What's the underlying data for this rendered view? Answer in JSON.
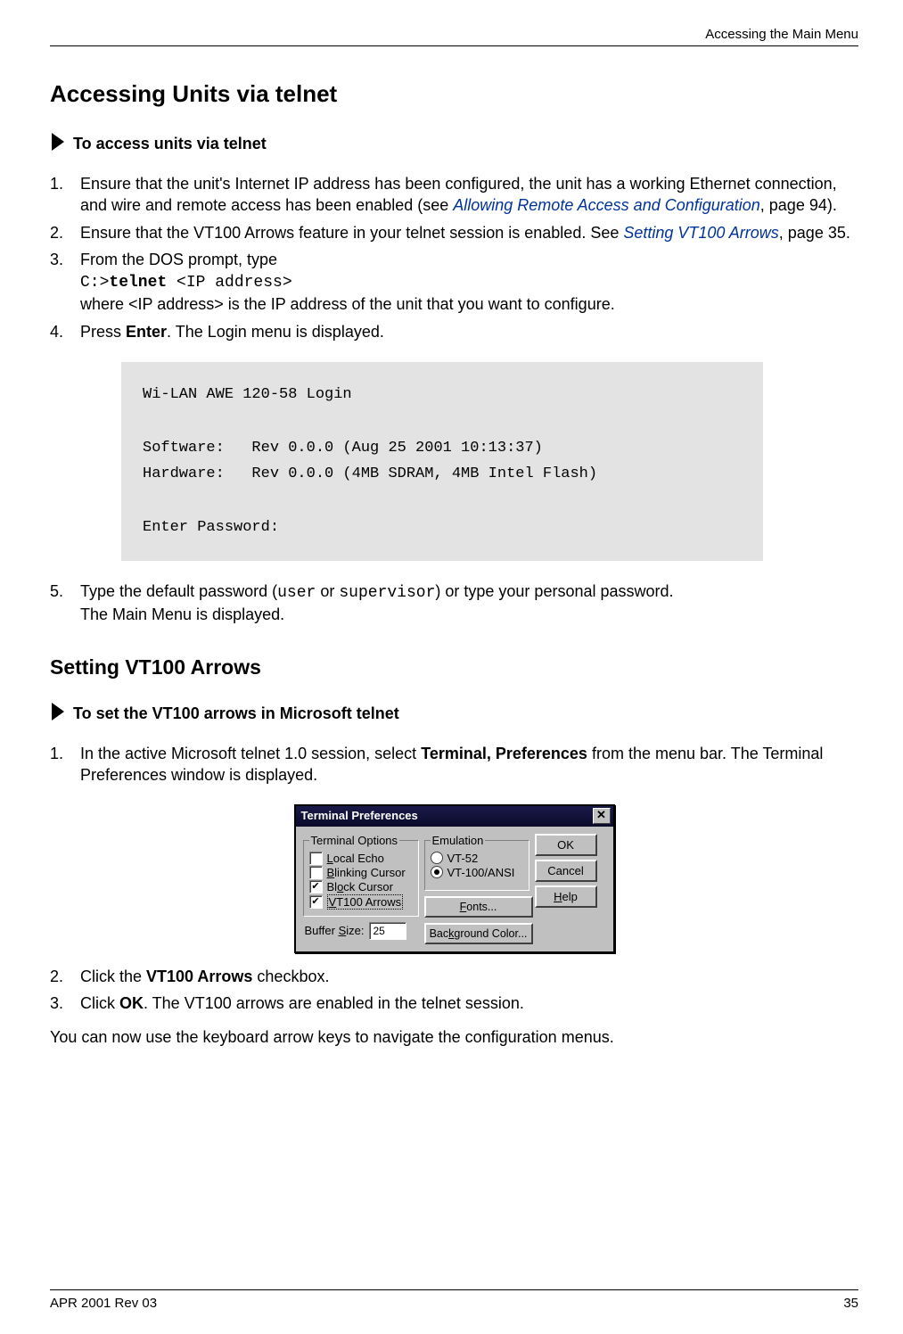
{
  "header": {
    "right": "Accessing the Main Menu"
  },
  "section1": {
    "title": "Accessing Units via telnet",
    "proc_label": "To access units via telnet",
    "steps": {
      "s1a": "Ensure that the unit's Internet IP address has been configured, the unit has a working Ethernet connection, and wire and remote access has been enabled (see ",
      "s1link": "Allowing Remote Access and Configuration",
      "s1b": ", page 94).",
      "s2a": "Ensure that the VT100 Arrows feature in your telnet session is enabled. See ",
      "s2link": "Setting VT100 Arrows",
      "s2b": ", page 35.",
      "s3a": "From the DOS prompt, type",
      "s3code_pre": "C:>",
      "s3code_bold": "telnet",
      "s3code_post": " <IP address>",
      "s3b": "where <IP address> is the IP address of the unit that you want to configure.",
      "s4a": "Press ",
      "s4key": "Enter",
      "s4b": ". The Login menu is displayed.",
      "s5a": "Type the default password (",
      "s5c1": "user",
      "s5m": " or ",
      "s5c2": "supervisor",
      "s5b": ") or type your personal password.",
      "s5c": "The Main Menu is displayed."
    },
    "codebox": "Wi-LAN AWE 120-58 Login\n\nSoftware:   Rev 0.0.0 (Aug 25 2001 10:13:37)\nHardware:   Rev 0.0.0 (4MB SDRAM, 4MB Intel Flash)\n\nEnter Password:"
  },
  "section2": {
    "title": "Setting VT100 Arrows",
    "proc_label": "To set the VT100 arrows in Microsoft telnet",
    "steps": {
      "s1a": "In the active Microsoft telnet 1.0 session, select ",
      "s1bold": "Terminal, Preferences",
      "s1b": " from the menu bar. The Terminal Preferences window is displayed.",
      "s2a": "Click the ",
      "s2bold": "VT100 Arrows",
      "s2b": " checkbox.",
      "s3a": "Click ",
      "s3bold": "OK",
      "s3b": ". The VT100 arrows are enabled in the telnet session."
    },
    "tail": "You can now use the keyboard arrow keys to navigate the configuration menus."
  },
  "dialog": {
    "title": "Terminal Preferences",
    "grp1": "Terminal Options",
    "opt_local_u": "L",
    "opt_local_r": "ocal Echo",
    "opt_blink_u": "B",
    "opt_blink_r": "linking Cursor",
    "opt_block_pre": "Bl",
    "opt_block_u": "o",
    "opt_block_r": "ck Cursor",
    "opt_vt100_u": "V",
    "opt_vt100_r": "T100 Arrows",
    "buffer_pre": "Buffer ",
    "buffer_u": "S",
    "buffer_r": "ize:",
    "buffer_val": "25",
    "grp2": "Emulation",
    "emu1": "VT-52",
    "emu2": "VT-100/ANSI",
    "fonts_u": "F",
    "fonts_r": "onts...",
    "bg_pre": "Bac",
    "bg_u": "k",
    "bg_r": "ground Color...",
    "btn_ok": "OK",
    "btn_cancel": "Cancel",
    "btn_help_u": "H",
    "btn_help_r": "elp"
  },
  "footer": {
    "left": "APR 2001 Rev 03",
    "right": "35"
  }
}
